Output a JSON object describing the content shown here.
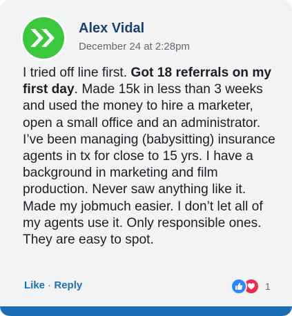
{
  "comment": {
    "author": "Alex Vidal",
    "timestamp": "December 24 at 2:28pm",
    "text_before": "I tried off line first. ",
    "text_bold": "Got 18 referrals on my first day",
    "text_after": ". Made 15k in less than 3 weeks and used the money to hire a marketer, open a small office and an administrator. I’ve been managing (babysitting) insurance agents in tx for close to 15 yrs. I have a background in marketing and film production. Never saw anything like it. Made my jobmuch easier. I don’t let all of my agents use it. Only responsible ones. They are easy to spot."
  },
  "actions": {
    "like_label": "Like",
    "separator": " · ",
    "reply_label": "Reply"
  },
  "reactions": {
    "icons": [
      "like-icon",
      "love-icon"
    ],
    "count": "1"
  },
  "colors": {
    "card_background": "#f2f3f5",
    "author_name": "#1c3f73",
    "link": "#1b6fb5",
    "avatar_green": "#3cc83c",
    "like_blue": "#2d88ff",
    "love_red": "#f02849",
    "bottom_bar": "#1b6fb5"
  }
}
